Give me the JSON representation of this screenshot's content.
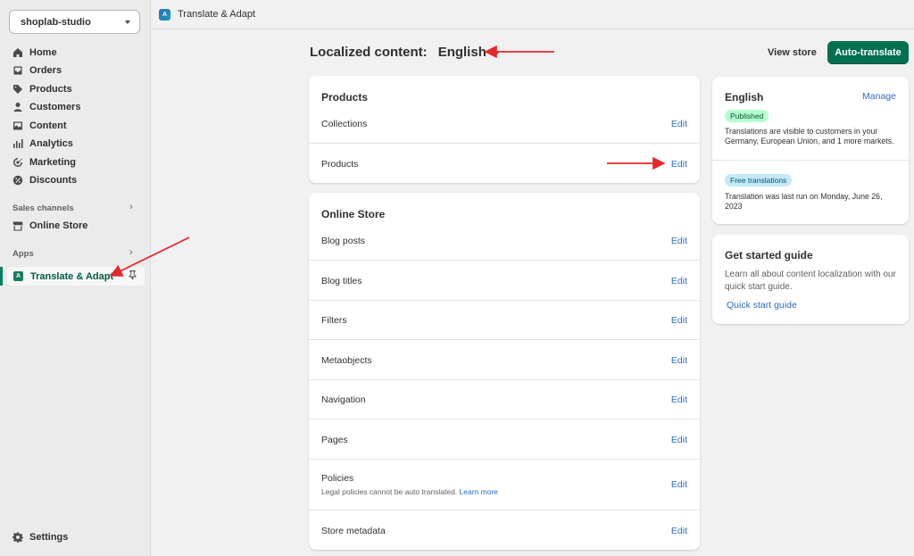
{
  "sidebar": {
    "store_name": "shoplab-studio",
    "nav": [
      {
        "label": "Home",
        "icon": "home-icon"
      },
      {
        "label": "Orders",
        "icon": "inbox-icon"
      },
      {
        "label": "Products",
        "icon": "tag-icon"
      },
      {
        "label": "Customers",
        "icon": "person-icon"
      },
      {
        "label": "Content",
        "icon": "image-icon"
      },
      {
        "label": "Analytics",
        "icon": "bar-chart-icon"
      },
      {
        "label": "Marketing",
        "icon": "target-icon"
      },
      {
        "label": "Discounts",
        "icon": "discount-icon"
      }
    ],
    "sales_channels_label": "Sales channels",
    "online_store_label": "Online Store",
    "apps_label": "Apps",
    "active_app_label": "Translate & Adapt",
    "settings_label": "Settings"
  },
  "topbar": {
    "title": "Translate & Adapt"
  },
  "header": {
    "label": "Localized content:",
    "language": "English",
    "view_store": "View store",
    "auto_translate": "Auto-translate"
  },
  "products_card": {
    "title": "Products",
    "rows": [
      {
        "label": "Collections",
        "action": "Edit"
      },
      {
        "label": "Products",
        "action": "Edit"
      }
    ]
  },
  "online_store_card": {
    "title": "Online Store",
    "rows": [
      {
        "label": "Blog posts",
        "action": "Edit"
      },
      {
        "label": "Blog titles",
        "action": "Edit"
      },
      {
        "label": "Filters",
        "action": "Edit"
      },
      {
        "label": "Metaobjects",
        "action": "Edit"
      },
      {
        "label": "Navigation",
        "action": "Edit"
      },
      {
        "label": "Pages",
        "action": "Edit"
      },
      {
        "label": "Policies",
        "action": "Edit",
        "sub": "Legal policies cannot be auto translated.",
        "sub_link": "Learn more"
      },
      {
        "label": "Store metadata",
        "action": "Edit"
      }
    ]
  },
  "language_card": {
    "title": "English",
    "manage": "Manage",
    "badge_published": "Published",
    "published_text": "Translations are visible to customers in your Germany, European Union, and 1 more markets.",
    "badge_free": "Free translations",
    "free_text": "Translation was last run on Monday, June 26, 2023"
  },
  "guide_card": {
    "title": "Get started guide",
    "text": "Learn all about content localization with our quick start guide.",
    "link": "Quick start guide"
  },
  "colors": {
    "accent_green": "#00704f",
    "link_blue": "#2c6ecb",
    "annotation_red": "#e5282e"
  }
}
